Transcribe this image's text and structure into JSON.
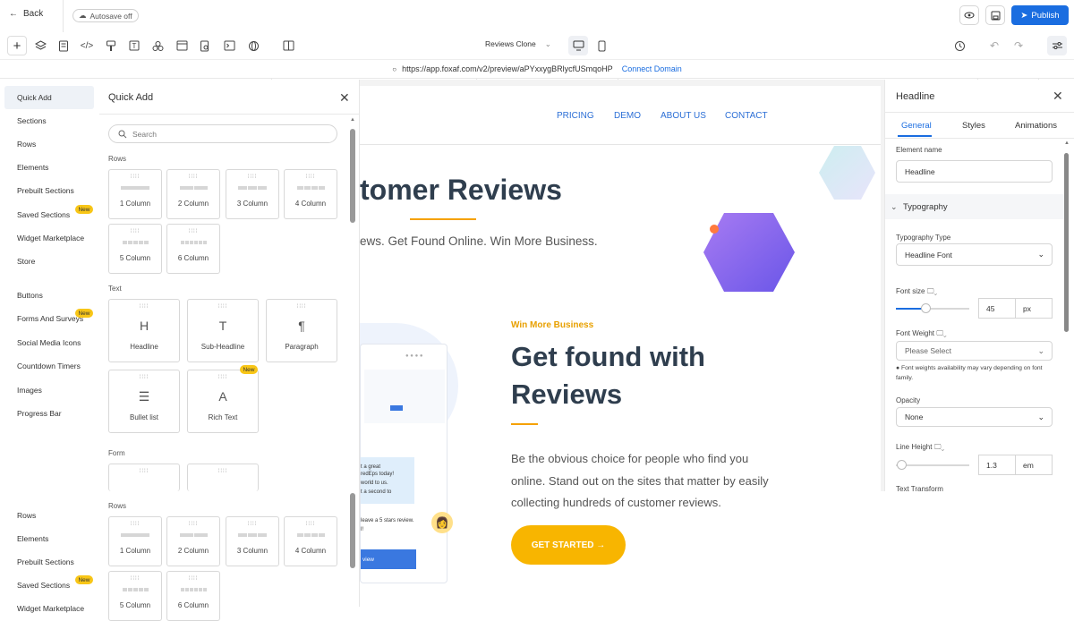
{
  "topbar": {
    "back_label": "Back",
    "autosave_label": "Autosave off",
    "publish_label": "Publish"
  },
  "toolbar": {
    "page_name": "Reviews Clone"
  },
  "urlbar": {
    "url": "https://app.foxaf.com/v2/preview/aPYxxygBRlycfUSmqoHP",
    "connect_label": "Connect Domain"
  },
  "leftnav": {
    "items": [
      {
        "label": "Quick Add",
        "active": true
      },
      {
        "label": "Sections"
      },
      {
        "label": "Rows"
      },
      {
        "label": "Elements"
      },
      {
        "label": "Prebuilt Sections"
      },
      {
        "label": "Saved Sections",
        "badge": "New"
      },
      {
        "label": "Widget Marketplace"
      },
      {
        "label": "Store"
      },
      {
        "label": "Buttons"
      },
      {
        "label": "Forms And Surveys",
        "badge": "New"
      },
      {
        "label": "Social Media Icons"
      },
      {
        "label": "Countdown Timers"
      },
      {
        "label": "Images"
      },
      {
        "label": "Progress Bar"
      }
    ],
    "dup_items": [
      {
        "label": "Rows"
      },
      {
        "label": "Elements"
      },
      {
        "label": "Prebuilt Sections"
      },
      {
        "label": "Saved Sections",
        "badge": "New"
      },
      {
        "label": "Widget Marketplace"
      }
    ]
  },
  "quickadd": {
    "title": "Quick Add",
    "search_placeholder": "Search",
    "rows_label": "Rows",
    "rows": [
      "1 Column",
      "2 Column",
      "3 Column",
      "4 Column",
      "5 Column",
      "6 Column"
    ],
    "text_label": "Text",
    "text_items": [
      {
        "label": "Headline",
        "icon": "H"
      },
      {
        "label": "Sub-Headline",
        "icon": "T"
      },
      {
        "label": "Paragraph",
        "icon": "¶"
      },
      {
        "label": "Bullet list",
        "icon": "☰"
      },
      {
        "label": "Rich Text",
        "icon": "A",
        "badge": "New"
      }
    ],
    "form_label": "Form",
    "rows2_label": "Rows",
    "rows2": [
      "1 Column",
      "2 Column",
      "3 Column",
      "4 Column",
      "5 Column",
      "6 Column"
    ]
  },
  "site": {
    "nav": [
      "PRICING",
      "DEMO",
      "ABOUT US",
      "CONTACT"
    ],
    "hero_title": "tomer Reviews",
    "hero_sub": "ews. Get Found Online. Win More Business.",
    "win_more": "Win More Business",
    "get_found_1": "Get found with",
    "get_found_2": "Reviews",
    "paragraph": "Be the obvious choice for people who find you online. Stand out on the sites that matter by easily collecting hundreds of customer reviews.",
    "cta": "GET STARTED →",
    "mock_lines": [
      "t a great",
      "redEps today!",
      "world to us.",
      "t a second to"
    ],
    "mock_leave": "leave a 5 stars review.",
    "mock_leave2": "l!",
    "mock_button": "view",
    "accent_color": "#f8b500",
    "title_color": "#2f3e4e"
  },
  "rightpanel": {
    "title": "Headline",
    "tabs": [
      "General",
      "Styles",
      "Animations"
    ],
    "element_name_label": "Element name",
    "element_name_value": "Headline",
    "typography_label": "Typography",
    "typography_type_label": "Typography Type",
    "typography_type_value": "Headline Font",
    "font_size_label": "Font size",
    "font_size_value": "45",
    "font_size_unit": "px",
    "font_size_level": 0.4,
    "font_weight_label": "Font Weight",
    "font_weight_placeholder": "Please Select",
    "font_weight_note": "Font weights availability may vary depending on font family.",
    "opacity_label": "Opacity",
    "opacity_value": "None",
    "line_height_label": "Line Height",
    "line_height_value": "1.3",
    "line_height_unit": "em",
    "text_transform_label": "Text Transform"
  }
}
